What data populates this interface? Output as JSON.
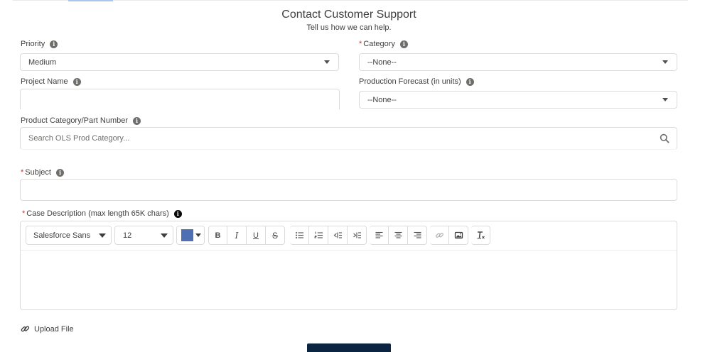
{
  "header": {
    "title": "Contact Customer Support",
    "subtitle": "Tell us how we can help."
  },
  "priority": {
    "label": "Priority",
    "value": "Medium"
  },
  "category": {
    "required_mark": "*",
    "label": "Category",
    "value": "--None--"
  },
  "project_name": {
    "label": "Project Name",
    "value": ""
  },
  "production_forecast": {
    "label": "Production Forecast (in units)",
    "value": "--None--"
  },
  "product_category": {
    "label": "Product Category/Part Number",
    "placeholder": "Search OLS Prod Category..."
  },
  "subject": {
    "required_mark": "*",
    "label": "Subject",
    "value": ""
  },
  "case_description": {
    "required_mark": "*",
    "label": "Case Description (max length 65K chars)",
    "toolbar": {
      "font_family": "Salesforce Sans",
      "font_size": "12",
      "text_color": "#4f6fb5",
      "bold": "B",
      "italic": "I",
      "underline": "U",
      "strikethrough": "S"
    }
  },
  "upload": {
    "label": "Upload File"
  },
  "info_glyph": "i",
  "colors": {
    "required": "#c23934",
    "submit": "#0b2540",
    "border": "#dddbda"
  }
}
